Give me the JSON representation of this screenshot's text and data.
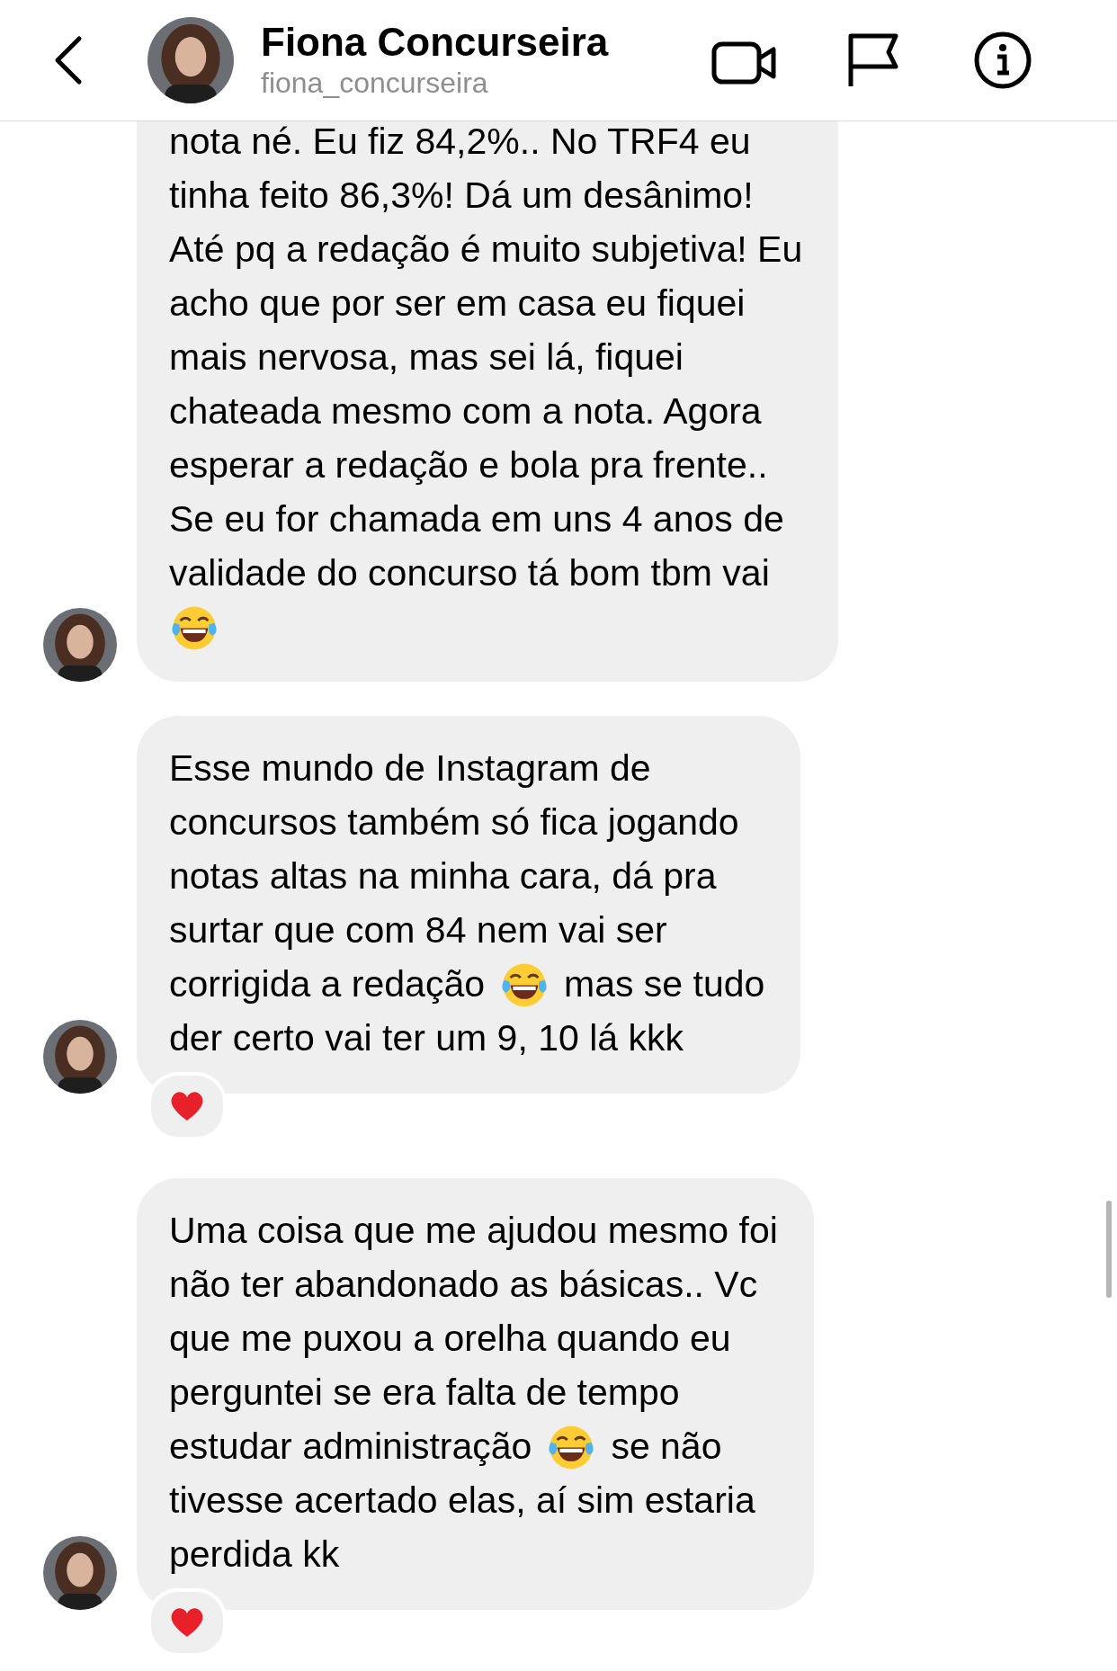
{
  "header": {
    "name": "Fiona Concurseira",
    "username": "fiona_concurseira"
  },
  "messages": [
    {
      "reacted": false,
      "lines": [
        [
          {
            "kind": "text",
            "text": "nota né. Eu fiz 84,2%.. No TRF4 eu"
          }
        ],
        [
          {
            "kind": "text",
            "text": "tinha feito 86,3%! Dá um desânimo!"
          }
        ],
        [
          {
            "kind": "text",
            "text": "Até pq a redação é muito subjetiva! Eu"
          }
        ],
        [
          {
            "kind": "text",
            "text": "acho que por ser em casa eu fiquei"
          }
        ],
        [
          {
            "kind": "text",
            "text": "mais nervosa, mas sei lá, fiquei"
          }
        ],
        [
          {
            "kind": "text",
            "text": "chateada mesmo com a nota. Agora"
          }
        ],
        [
          {
            "kind": "text",
            "text": "esperar a redação e bola pra frente.."
          }
        ],
        [
          {
            "kind": "text",
            "text": "Se eu for chamada em uns 4 anos de"
          }
        ],
        [
          {
            "kind": "text",
            "text": "validade do concurso tá bom tbm vai"
          }
        ],
        [
          {
            "kind": "emoji"
          }
        ]
      ]
    },
    {
      "reacted": true,
      "lines": [
        [
          {
            "kind": "text",
            "text": "Esse mundo de Instagram de"
          }
        ],
        [
          {
            "kind": "text",
            "text": "concursos também só fica jogando"
          }
        ],
        [
          {
            "kind": "text",
            "text": "notas altas na minha cara, dá pra"
          }
        ],
        [
          {
            "kind": "text",
            "text": "surtar que com 84 nem vai ser"
          }
        ],
        [
          {
            "kind": "text",
            "text": "corrigida a redação"
          },
          {
            "kind": "emoji"
          },
          {
            "kind": "text",
            "text": "mas se tudo"
          }
        ],
        [
          {
            "kind": "text",
            "text": "der certo vai ter um 9, 10 lá kkk"
          }
        ]
      ]
    },
    {
      "reacted": true,
      "lines": [
        [
          {
            "kind": "text",
            "text": "Uma coisa que me ajudou mesmo foi"
          }
        ],
        [
          {
            "kind": "text",
            "text": "não ter abandonado as básicas.. Vc"
          }
        ],
        [
          {
            "kind": "text",
            "text": "que me puxou a orelha quando eu"
          }
        ],
        [
          {
            "kind": "text",
            "text": "perguntei se era falta de tempo"
          }
        ],
        [
          {
            "kind": "text",
            "text": "estudar administração"
          },
          {
            "kind": "emoji"
          },
          {
            "kind": "text",
            "text": "se não"
          }
        ],
        [
          {
            "kind": "text",
            "text": "tivesse acertado elas, aí sim estaria"
          }
        ],
        [
          {
            "kind": "text",
            "text": "perdida kk"
          }
        ]
      ]
    }
  ]
}
